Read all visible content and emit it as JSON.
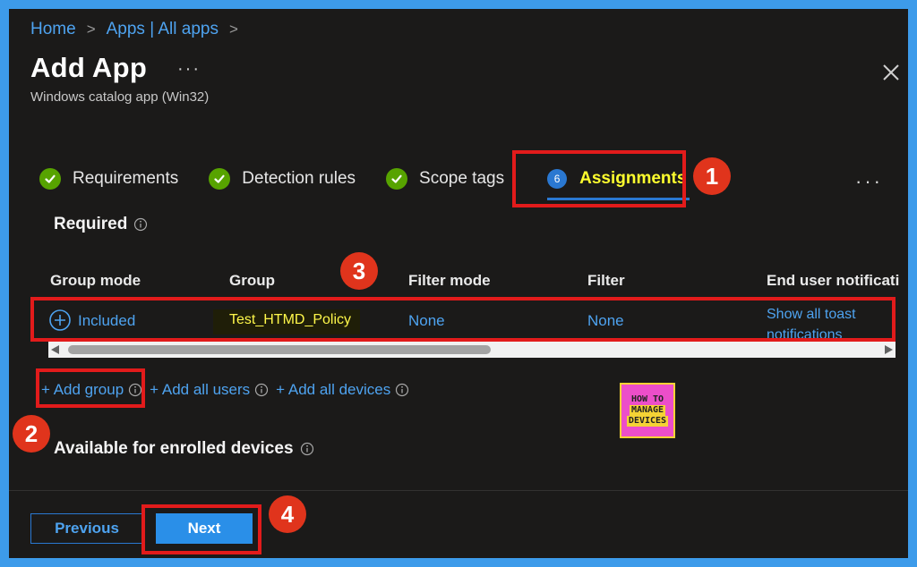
{
  "breadcrumb": {
    "home": "Home",
    "apps": "Apps | All apps",
    "separator": ">"
  },
  "header": {
    "title": "Add App",
    "more_label": "···",
    "subtitle": "Windows catalog app (Win32)",
    "close_label": "✕"
  },
  "steps": [
    {
      "label": "Requirements",
      "state": "complete"
    },
    {
      "label": "Detection rules",
      "state": "complete"
    },
    {
      "label": "Scope tags",
      "state": "complete"
    },
    {
      "number": "6",
      "label": "Assignments",
      "state": "active"
    }
  ],
  "steps_more": "···",
  "sections": {
    "required": "Required",
    "available": "Available for enrolled devices"
  },
  "table": {
    "headers": [
      "Group mode",
      "Group",
      "Filter mode",
      "Filter",
      "End user notificati"
    ],
    "row": {
      "group_mode": "Included",
      "group": "Test_HTMD_Policy",
      "filter_mode": "None",
      "filter": "None",
      "notifications": "Show all toast notifications"
    },
    "scroll_position": 0
  },
  "add_links": {
    "add_group": "+ Add group",
    "add_all_users": "+ Add all users",
    "add_all_devices": "+ Add all devices"
  },
  "logo": {
    "line1": "HOW TO",
    "line2": "MANAGE",
    "line3": "DEVICES"
  },
  "footer": {
    "previous_label": "Previous",
    "next_label": "Next"
  },
  "annotations": [
    "1",
    "2",
    "3",
    "4"
  ],
  "colors": {
    "panel_background": "#1b1a19",
    "outer_background": "#3d9bea",
    "link": "#4ea3f0",
    "accent": "#2a78d1",
    "success": "#57a300",
    "active_step_text": "#ffff2e",
    "highlight_red": "#e21b1b",
    "badge_red": "#e0341c"
  }
}
